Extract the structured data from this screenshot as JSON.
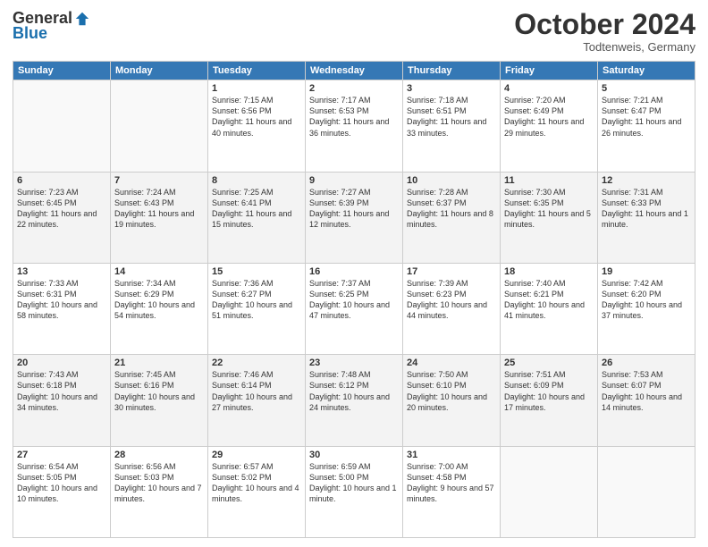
{
  "header": {
    "logo_general": "General",
    "logo_blue": "Blue",
    "month": "October 2024",
    "location": "Todtenweis, Germany"
  },
  "days_of_week": [
    "Sunday",
    "Monday",
    "Tuesday",
    "Wednesday",
    "Thursday",
    "Friday",
    "Saturday"
  ],
  "weeks": [
    [
      {
        "day": "",
        "info": ""
      },
      {
        "day": "",
        "info": ""
      },
      {
        "day": "1",
        "info": "Sunrise: 7:15 AM\nSunset: 6:56 PM\nDaylight: 11 hours and 40 minutes."
      },
      {
        "day": "2",
        "info": "Sunrise: 7:17 AM\nSunset: 6:53 PM\nDaylight: 11 hours and 36 minutes."
      },
      {
        "day": "3",
        "info": "Sunrise: 7:18 AM\nSunset: 6:51 PM\nDaylight: 11 hours and 33 minutes."
      },
      {
        "day": "4",
        "info": "Sunrise: 7:20 AM\nSunset: 6:49 PM\nDaylight: 11 hours and 29 minutes."
      },
      {
        "day": "5",
        "info": "Sunrise: 7:21 AM\nSunset: 6:47 PM\nDaylight: 11 hours and 26 minutes."
      }
    ],
    [
      {
        "day": "6",
        "info": "Sunrise: 7:23 AM\nSunset: 6:45 PM\nDaylight: 11 hours and 22 minutes."
      },
      {
        "day": "7",
        "info": "Sunrise: 7:24 AM\nSunset: 6:43 PM\nDaylight: 11 hours and 19 minutes."
      },
      {
        "day": "8",
        "info": "Sunrise: 7:25 AM\nSunset: 6:41 PM\nDaylight: 11 hours and 15 minutes."
      },
      {
        "day": "9",
        "info": "Sunrise: 7:27 AM\nSunset: 6:39 PM\nDaylight: 11 hours and 12 minutes."
      },
      {
        "day": "10",
        "info": "Sunrise: 7:28 AM\nSunset: 6:37 PM\nDaylight: 11 hours and 8 minutes."
      },
      {
        "day": "11",
        "info": "Sunrise: 7:30 AM\nSunset: 6:35 PM\nDaylight: 11 hours and 5 minutes."
      },
      {
        "day": "12",
        "info": "Sunrise: 7:31 AM\nSunset: 6:33 PM\nDaylight: 11 hours and 1 minute."
      }
    ],
    [
      {
        "day": "13",
        "info": "Sunrise: 7:33 AM\nSunset: 6:31 PM\nDaylight: 10 hours and 58 minutes."
      },
      {
        "day": "14",
        "info": "Sunrise: 7:34 AM\nSunset: 6:29 PM\nDaylight: 10 hours and 54 minutes."
      },
      {
        "day": "15",
        "info": "Sunrise: 7:36 AM\nSunset: 6:27 PM\nDaylight: 10 hours and 51 minutes."
      },
      {
        "day": "16",
        "info": "Sunrise: 7:37 AM\nSunset: 6:25 PM\nDaylight: 10 hours and 47 minutes."
      },
      {
        "day": "17",
        "info": "Sunrise: 7:39 AM\nSunset: 6:23 PM\nDaylight: 10 hours and 44 minutes."
      },
      {
        "day": "18",
        "info": "Sunrise: 7:40 AM\nSunset: 6:21 PM\nDaylight: 10 hours and 41 minutes."
      },
      {
        "day": "19",
        "info": "Sunrise: 7:42 AM\nSunset: 6:20 PM\nDaylight: 10 hours and 37 minutes."
      }
    ],
    [
      {
        "day": "20",
        "info": "Sunrise: 7:43 AM\nSunset: 6:18 PM\nDaylight: 10 hours and 34 minutes."
      },
      {
        "day": "21",
        "info": "Sunrise: 7:45 AM\nSunset: 6:16 PM\nDaylight: 10 hours and 30 minutes."
      },
      {
        "day": "22",
        "info": "Sunrise: 7:46 AM\nSunset: 6:14 PM\nDaylight: 10 hours and 27 minutes."
      },
      {
        "day": "23",
        "info": "Sunrise: 7:48 AM\nSunset: 6:12 PM\nDaylight: 10 hours and 24 minutes."
      },
      {
        "day": "24",
        "info": "Sunrise: 7:50 AM\nSunset: 6:10 PM\nDaylight: 10 hours and 20 minutes."
      },
      {
        "day": "25",
        "info": "Sunrise: 7:51 AM\nSunset: 6:09 PM\nDaylight: 10 hours and 17 minutes."
      },
      {
        "day": "26",
        "info": "Sunrise: 7:53 AM\nSunset: 6:07 PM\nDaylight: 10 hours and 14 minutes."
      }
    ],
    [
      {
        "day": "27",
        "info": "Sunrise: 6:54 AM\nSunset: 5:05 PM\nDaylight: 10 hours and 10 minutes."
      },
      {
        "day": "28",
        "info": "Sunrise: 6:56 AM\nSunset: 5:03 PM\nDaylight: 10 hours and 7 minutes."
      },
      {
        "day": "29",
        "info": "Sunrise: 6:57 AM\nSunset: 5:02 PM\nDaylight: 10 hours and 4 minutes."
      },
      {
        "day": "30",
        "info": "Sunrise: 6:59 AM\nSunset: 5:00 PM\nDaylight: 10 hours and 1 minute."
      },
      {
        "day": "31",
        "info": "Sunrise: 7:00 AM\nSunset: 4:58 PM\nDaylight: 9 hours and 57 minutes."
      },
      {
        "day": "",
        "info": ""
      },
      {
        "day": "",
        "info": ""
      }
    ]
  ]
}
